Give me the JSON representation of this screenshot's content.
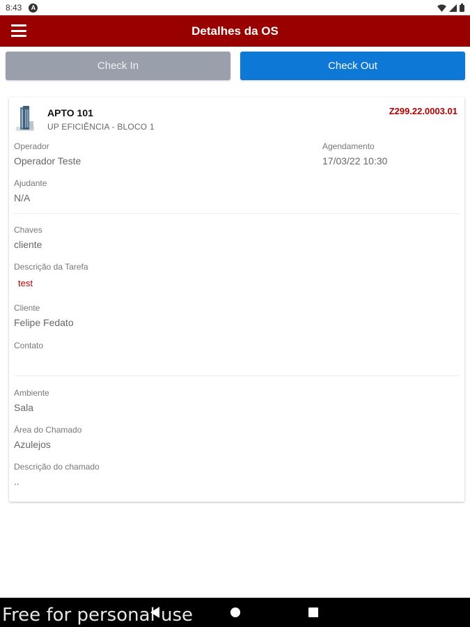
{
  "status_bar": {
    "time": "8:43",
    "badge": "A"
  },
  "app_bar": {
    "title": "Detalhes da OS"
  },
  "actions": {
    "check_in": "Check In",
    "check_out": "Check Out"
  },
  "header": {
    "unit": "APTO 101",
    "building": "UP EFICIÊNCIA - BLOCO 1",
    "code": "Z299.22.0003.01"
  },
  "fields": {
    "operador_label": "Operador",
    "operador_value": "Operador Teste",
    "agendamento_label": "Agendamento",
    "agendamento_value": "17/03/22 10:30",
    "ajudante_label": "Ajudante",
    "ajudante_value": "N/A",
    "chaves_label": "Chaves",
    "chaves_value": "cliente",
    "descricao_tarefa_label": "Descrição da Tarefa",
    "descricao_tarefa_value": "test",
    "cliente_label": "Cliente",
    "cliente_value": "Felipe Fedato",
    "contato_label": "Contato",
    "contato_value": "",
    "ambiente_label": "Ambiente",
    "ambiente_value": "Sala",
    "area_label": "Área do Chamado",
    "area_value": "Azulejos",
    "descricao_chamado_label": "Descrição do chamado",
    "descricao_chamado_value": ".."
  },
  "watermark": "Free for personal use",
  "colors": {
    "app_bar": "#990000",
    "check_in": "#9aa0ab",
    "check_out": "#0d78d6",
    "code": "#b00000"
  }
}
